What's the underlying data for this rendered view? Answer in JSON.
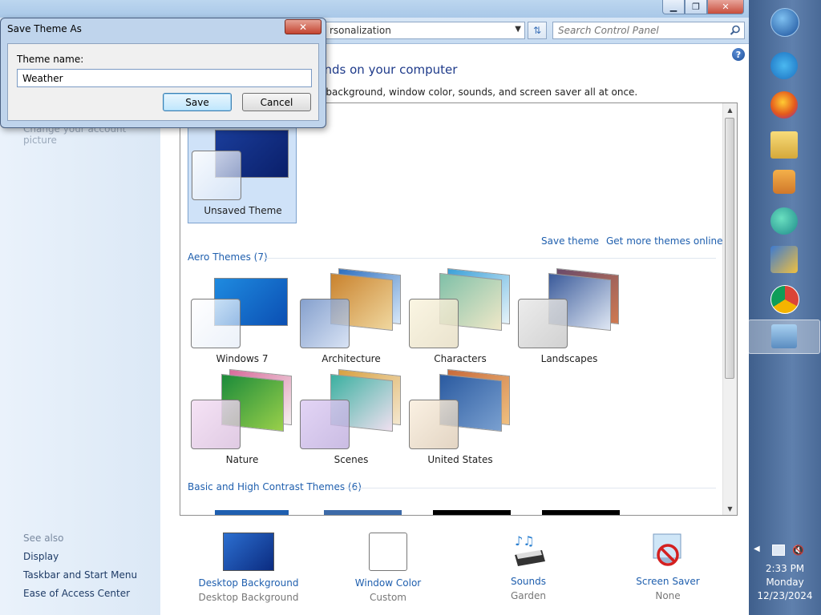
{
  "address": {
    "breadcrumb": "rsonalization",
    "search_placeholder": "Search Control Panel"
  },
  "sidebar": {
    "partial_link": "Change your account picture",
    "see_also_heading": "See also",
    "links": [
      "Display",
      "Taskbar and Start Menu",
      "Ease of Access Center"
    ]
  },
  "main": {
    "heading": "unds on your computer",
    "subtext": "p background, window color, sounds, and screen saver all at once."
  },
  "themes": {
    "my_theme": {
      "label": "Unsaved Theme"
    },
    "save_theme_link": "Save theme",
    "more_themes_link": "Get more themes online",
    "aero_heading": "Aero Themes (7)",
    "aero": [
      "Windows 7",
      "Architecture",
      "Characters",
      "Landscapes",
      "Nature",
      "Scenes",
      "United States"
    ],
    "basic_heading": "Basic and High Contrast Themes (6)"
  },
  "bottom_bar": [
    {
      "title": "Desktop Background",
      "sub": "Desktop Background"
    },
    {
      "title": "Window Color",
      "sub": "Custom"
    },
    {
      "title": "Sounds",
      "sub": "Garden"
    },
    {
      "title": "Screen Saver",
      "sub": "None"
    }
  ],
  "dialog": {
    "title": "Save Theme As",
    "label": "Theme name:",
    "input_value": "Weather",
    "save_label": "Save",
    "cancel_label": "Cancel"
  },
  "clock": {
    "time": "2:33 PM",
    "day": "Monday",
    "date": "12/23/2024"
  },
  "colors": {
    "link": "#1f5fae",
    "taskbar": "#4f70a0"
  }
}
